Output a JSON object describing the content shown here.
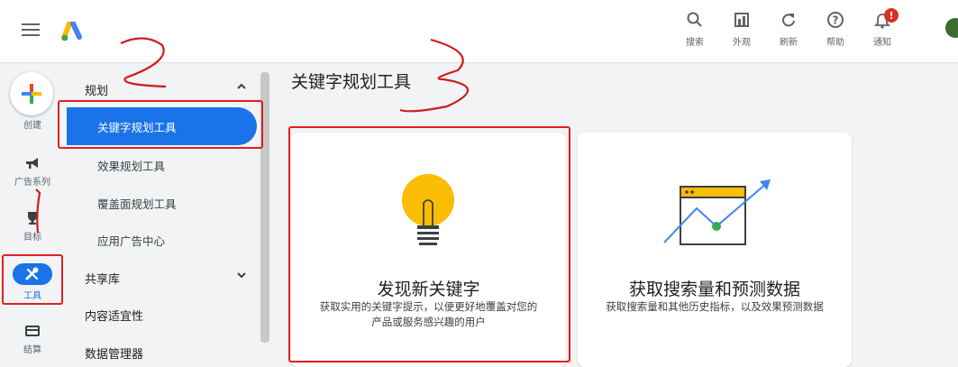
{
  "topbar": {
    "tools": [
      {
        "icon": "search-icon",
        "label": "搜索"
      },
      {
        "icon": "appearance-icon",
        "label": "外观"
      },
      {
        "icon": "refresh-icon",
        "label": "刷新"
      },
      {
        "icon": "help-icon",
        "label": "帮助"
      },
      {
        "icon": "bell-icon",
        "label": "通知",
        "badge": "!"
      }
    ]
  },
  "rail": {
    "create_label": "创建",
    "items": [
      {
        "icon": "megaphone-icon",
        "label": "广告系列"
      },
      {
        "icon": "trophy-icon",
        "label": "目标"
      },
      {
        "icon": "tools-icon",
        "label": "工具"
      },
      {
        "icon": "billing-icon",
        "label": "结算"
      }
    ]
  },
  "subnav": {
    "group_plan": "规划",
    "active_item": "关键字规划工具",
    "items": [
      "效果规划工具",
      "覆盖面规划工具",
      "应用广告中心"
    ],
    "group_shared": "共享库",
    "content_suitability": "内容适宜性",
    "data_manager": "数据管理器"
  },
  "main": {
    "title": "关键字规划工具",
    "card1": {
      "title": "发现新关键字",
      "desc_line1": "获取实用的关键字提示，以便更好地覆盖对您的",
      "desc_line2": "产品或服务感兴趣的用户"
    },
    "card2": {
      "title": "获取搜索量和预测数据",
      "desc_line1": "获取搜索量和其他历史指标，以及效果预测数据"
    }
  },
  "colors": {
    "accent": "#1a73e8",
    "annotation_red": "#e02020",
    "bulb_yellow": "#fbbc04",
    "trend_green": "#34a853"
  }
}
